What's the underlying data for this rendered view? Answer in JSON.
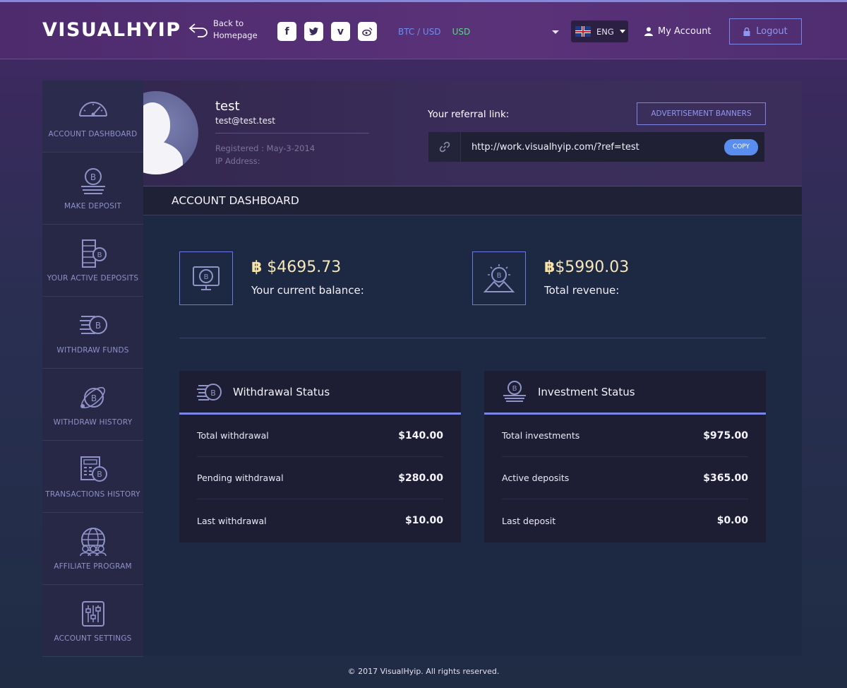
{
  "header": {
    "logo": "VISUALHYIP",
    "back_line1": "Back to",
    "back_line2": "Homepage",
    "social": [
      "f",
      "t",
      "v",
      "w"
    ],
    "currency_pair": "BTC / USD",
    "currency_selected": "USD",
    "language": "ENG",
    "my_account": "My Account",
    "logout": "Logout"
  },
  "sidebar": {
    "items": [
      {
        "label": "ACCOUNT DASHBOARD",
        "icon": "speedometer-icon"
      },
      {
        "label": "MAKE DEPOSIT",
        "icon": "coin-stack-icon"
      },
      {
        "label": "YOUR ACTIVE DEPOSITS",
        "icon": "server-coin-icon"
      },
      {
        "label": "WITHDRAW FUNDS",
        "icon": "fast-coin-icon"
      },
      {
        "label": "WITHDRAW HISTORY",
        "icon": "orbit-coin-icon"
      },
      {
        "label": "TRANSACTIONS HISTORY",
        "icon": "calculator-coin-icon"
      },
      {
        "label": "AFFILIATE PROGRAM",
        "icon": "globe-users-icon"
      },
      {
        "label": "ACCOUNT SETTINGS",
        "icon": "sliders-icon"
      }
    ]
  },
  "profile": {
    "name": "test",
    "email": "test@test.test",
    "registered": "Registered : May-3-2014",
    "ip": "IP Address:",
    "referral_label": "Your referral link:",
    "referral_url": "http://work.visualhyip.com/?ref=test",
    "copy": "COPY",
    "ad_banners": "ADVERTISEMENT BANNERS"
  },
  "section_title": "ACCOUNT DASHBOARD",
  "stats": {
    "balance_symbol": "฿",
    "balance_value": " $4695.73",
    "balance_label": "Your current balance:",
    "revenue_symbol": "฿",
    "revenue_value": "$5990.03",
    "revenue_label": "Total revenue:"
  },
  "withdrawal": {
    "title": "Withdrawal Status",
    "rows": [
      {
        "label": "Total withdrawal",
        "value": "$140.00"
      },
      {
        "label": "Pending withdrawal",
        "value": "$280.00"
      },
      {
        "label": "Last withdrawal",
        "value": "$10.00"
      }
    ]
  },
  "investment": {
    "title": "Investment Status",
    "rows": [
      {
        "label": "Total investments",
        "value": "$975.00"
      },
      {
        "label": "Active deposits",
        "value": "$365.00"
      },
      {
        "label": "Last deposit",
        "value": "$0.00"
      }
    ]
  },
  "footer": "© 2017 VisualHyip. All rights reserved.",
  "colors": {
    "accent": "#7b85e8",
    "currency_green": "#5fd38a",
    "btc_gold": "#f6e6b8"
  }
}
